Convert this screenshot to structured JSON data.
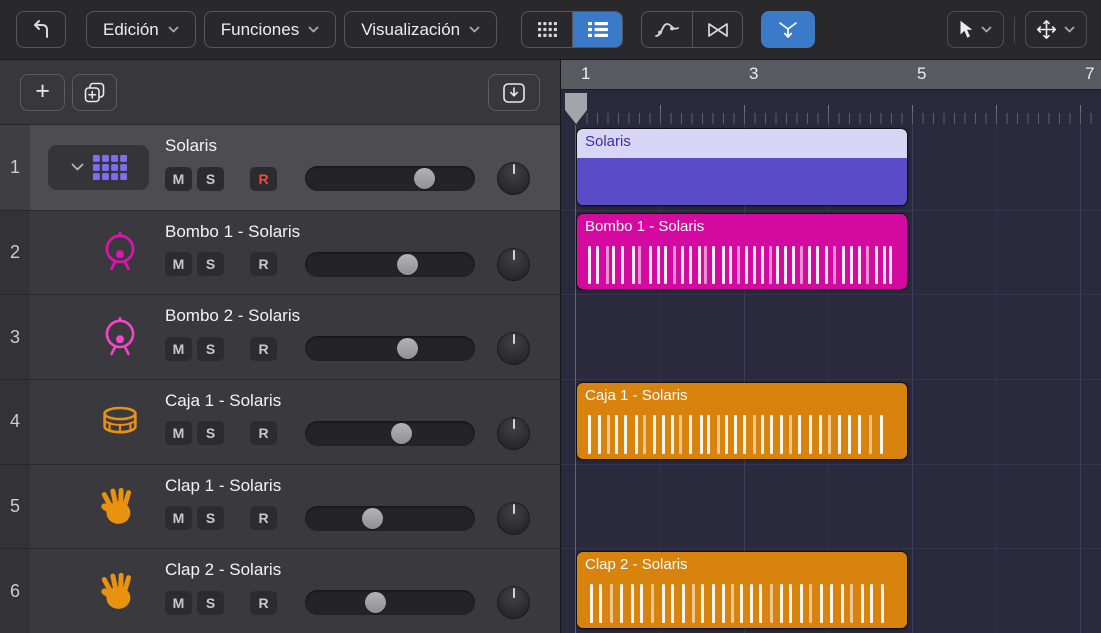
{
  "toolbar": {
    "menus": [
      {
        "label": "Edición"
      },
      {
        "label": "Funciones"
      },
      {
        "label": "Visualización"
      }
    ],
    "icon_buttons": [
      "back",
      "grid-view",
      "rows-view",
      "automation-curve",
      "transform",
      "catch-playhead",
      "pointer-tool",
      "crosshair-tool"
    ],
    "active_buttons": [
      "rows-view",
      "catch-playhead"
    ],
    "accent_color": "#3b79c9"
  },
  "panel": {
    "add_label": "+",
    "icon_buttons": [
      "add-track",
      "duplicate-track",
      "show-hide-tray"
    ]
  },
  "buttons": {
    "mute": "M",
    "solo": "S",
    "record": "R"
  },
  "ruler": {
    "marks": [
      {
        "label": "1",
        "measure": 0
      },
      {
        "label": "3",
        "measure": 2
      },
      {
        "label": "5",
        "measure": 4
      },
      {
        "label": "7",
        "measure": 6
      }
    ]
  },
  "arrange": {
    "playhead_measure": 1
  },
  "colors": {
    "record_red": "#ff453a"
  },
  "tracks": [
    {
      "number": "1",
      "name": "Solaris",
      "icon": "drum-machine-icon",
      "icon_color": "#7d6ff2",
      "selected": true,
      "collapsible": true,
      "record_armed": true,
      "slider": 0.74,
      "pan": 0
    },
    {
      "number": "2",
      "name": "Bombo 1 - Solaris",
      "icon": "kick-drum-icon",
      "icon_color": "#e212b2",
      "selected": false,
      "collapsible": false,
      "record_armed": false,
      "slider": 0.62,
      "pan": 0
    },
    {
      "number": "3",
      "name": "Bombo 2 - Solaris",
      "icon": "kick-drum-icon",
      "icon_color": "#f446c6",
      "selected": false,
      "collapsible": false,
      "record_armed": false,
      "slider": 0.62,
      "pan": 0
    },
    {
      "number": "4",
      "name": "Caja 1 - Solaris",
      "icon": "snare-drum-icon",
      "icon_color": "#e89210",
      "selected": false,
      "collapsible": false,
      "record_armed": false,
      "slider": 0.58,
      "pan": 0
    },
    {
      "number": "5",
      "name": "Clap 1 - Solaris",
      "icon": "clap-icon",
      "icon_color": "#e89210",
      "selected": false,
      "collapsible": false,
      "record_armed": false,
      "slider": 0.38,
      "pan": 0
    },
    {
      "number": "6",
      "name": "Clap 2 - Solaris",
      "icon": "clap-icon",
      "icon_color": "#e89210",
      "selected": false,
      "collapsible": false,
      "record_armed": false,
      "slider": 0.4,
      "pan": 0
    }
  ],
  "regions": [
    {
      "track_index": 0,
      "name": "Solaris",
      "type": "pattern",
      "start_measure": 0,
      "bars": 4,
      "header_bg": "#d9d5f6",
      "header_text": "#3c2fa6",
      "body_bg": "#5a4cc7",
      "notes": []
    },
    {
      "track_index": 1,
      "name": "Bombo 1 - Solaris",
      "type": "notes",
      "start_measure": 0,
      "bars": 4,
      "header_bg": "#d40aa0",
      "header_text": "#ffffff",
      "body_bg": "#d40aa0",
      "notes": [
        0.015,
        0.04,
        0.07,
        0.09,
        0.12,
        0.155,
        0.175,
        0.21,
        0.235,
        0.255,
        0.285,
        0.31,
        0.335,
        0.365,
        0.385,
        0.41,
        0.44,
        0.465,
        0.49,
        0.515,
        0.54,
        0.565,
        0.59,
        0.615,
        0.64,
        0.665,
        0.69,
        0.715,
        0.74,
        0.77,
        0.795,
        0.825,
        0.85,
        0.875,
        0.9,
        0.93,
        0.955,
        0.975
      ]
    },
    {
      "track_index": 3,
      "name": "Caja 1 - Solaris",
      "type": "notes",
      "start_measure": 0,
      "bars": 4,
      "header_bg": "#d9830f",
      "header_text": "#ffffff",
      "body_bg": "#d9830f",
      "notes": [
        0.015,
        0.045,
        0.075,
        0.1,
        0.13,
        0.165,
        0.19,
        0.22,
        0.25,
        0.28,
        0.305,
        0.335,
        0.37,
        0.395,
        0.425,
        0.45,
        0.48,
        0.51,
        0.54,
        0.565,
        0.595,
        0.625,
        0.655,
        0.685,
        0.72,
        0.75,
        0.78,
        0.81,
        0.845,
        0.875,
        0.91,
        0.945
      ]
    },
    {
      "track_index": 5,
      "name": "Clap 2 - Solaris",
      "type": "notes",
      "start_measure": 0,
      "bars": 4,
      "header_bg": "#d9830f",
      "header_text": "#ffffff",
      "body_bg": "#d9830f",
      "notes": [
        0.02,
        0.05,
        0.085,
        0.115,
        0.15,
        0.18,
        0.215,
        0.25,
        0.28,
        0.315,
        0.345,
        0.375,
        0.41,
        0.44,
        0.47,
        0.5,
        0.53,
        0.56,
        0.595,
        0.625,
        0.655,
        0.69,
        0.72,
        0.755,
        0.785,
        0.82,
        0.85,
        0.885,
        0.915,
        0.95
      ]
    }
  ]
}
